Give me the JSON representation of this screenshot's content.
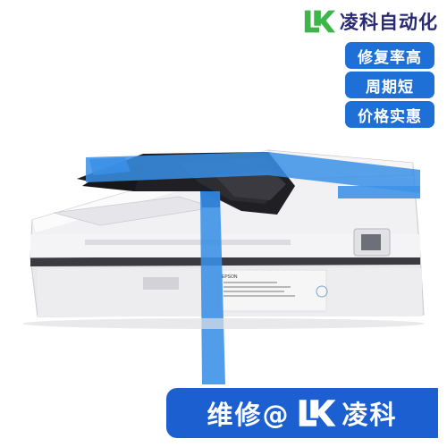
{
  "brand": {
    "name": "凌科自动化",
    "logo_letters": "LK",
    "logo_color": "#3db54a",
    "text_color": "#2a2a72"
  },
  "badges": [
    {
      "label": "修复率高"
    },
    {
      "label": "周期短"
    },
    {
      "label": "价格实惠"
    }
  ],
  "badge_color": "#1e6fd6",
  "product": {
    "label_brand": "EPSON",
    "tape_color": "#3a8fe6"
  },
  "footer": {
    "left_text": "维修@",
    "right_text": "凌科",
    "background": "#1c5fd0"
  }
}
